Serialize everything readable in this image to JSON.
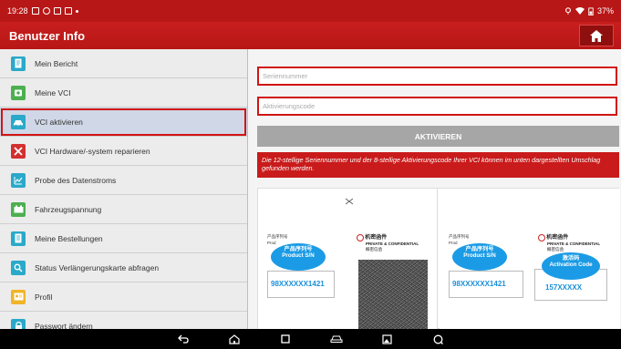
{
  "status_bar": {
    "time": "19:28",
    "battery": "37%"
  },
  "app_bar": {
    "title": "Benutzer Info"
  },
  "sidebar": {
    "items": [
      {
        "label": "Mein Bericht",
        "icon": "document-icon",
        "color": "#2aa9c9"
      },
      {
        "label": "Meine VCI",
        "icon": "vci-device-icon",
        "color": "#4caf50"
      },
      {
        "label": "VCI aktivieren",
        "icon": "car-activate-icon",
        "color": "#2aa9c9",
        "active": true
      },
      {
        "label": "VCI Hardware/-system reparieren",
        "icon": "tools-icon",
        "color": "#d32f2f"
      },
      {
        "label": "Probe des Datenstroms",
        "icon": "chart-icon",
        "color": "#2aa9c9"
      },
      {
        "label": "Fahrzeugspannung",
        "icon": "battery-icon",
        "color": "#4caf50"
      },
      {
        "label": "Meine Bestellungen",
        "icon": "orders-icon",
        "color": "#2aa9c9"
      },
      {
        "label": "Status Verlängerungskarte abfragen",
        "icon": "search-icon",
        "color": "#2aa9c9"
      },
      {
        "label": "Profil",
        "icon": "profile-icon",
        "color": "#f0b429"
      },
      {
        "label": "Passwort ändern",
        "icon": "lock-icon",
        "color": "#2aa9c9"
      }
    ]
  },
  "form": {
    "serial_placeholder": "Seriennummer",
    "activation_placeholder": "Aktivierungscode",
    "activate_label": "AKTIVIEREN",
    "info_text": "Die 12-stellige Seriennummer und der 8-stellige Aktivierungscode Ihrer VCI können im unten dargestellten Umschlag gefunden werden."
  },
  "envelope_left": {
    "sn_cn": "产品序列号",
    "sn_en": "Product S/N",
    "sn_value": "98XXXXXX1421",
    "conf_cn": "机密函件",
    "conf_en": "PRIVATE & CONFIDENTIAL",
    "conf_cn2": "概密信函",
    "label_cn_small": "产品序列号",
    "label_prod": "Prod"
  },
  "envelope_right": {
    "sn_cn": "产品序列号",
    "sn_en": "Product S/N",
    "sn_value": "98XXXXXX1421",
    "conf_cn": "机密函件",
    "conf_en": "PRIVATE & CONFIDENTIAL",
    "conf_cn2": "概密信函",
    "code_cn": "激活码",
    "code_en": "Activation Code",
    "code_value": "157XXXXX",
    "label_cn_small": "产品序列号",
    "label_prod": "Prod"
  }
}
